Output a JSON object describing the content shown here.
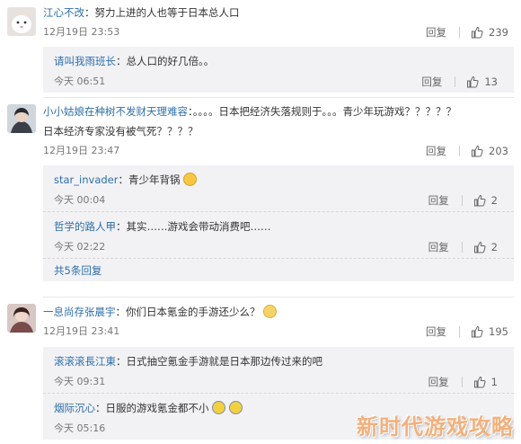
{
  "comments": [
    {
      "user": "江心不改",
      "text": "：努力上进的人也等于日本总人口",
      "time": "12月19日 23:53",
      "reply": "回复",
      "likes": "239",
      "replies": [
        {
          "user": "请叫我雨班长",
          "text": "：总人口的好几倍。。",
          "time": "今天 06:51",
          "reply": "回复",
          "likes": "13"
        }
      ]
    },
    {
      "user": "小小姑娘在种树不发财天理难容",
      "text_line1": "：。。。。日本把经济失落规则于。。。青少年玩游戏？？？？？",
      "text_line2": "日本经济专家没有被气死？？？？",
      "time": "12月19日 23:47",
      "reply": "回复",
      "likes": "203",
      "replies": [
        {
          "user": "star_invader",
          "text": "：青少年背锅",
          "time": "今天 00:04",
          "reply": "回复",
          "likes": "2"
        },
        {
          "user": "哲学的路人甲",
          "text": "：其实……游戏会带动消费吧……",
          "time": "今天 02:22",
          "reply": "回复",
          "likes": "2"
        }
      ],
      "more": "共5条回复"
    },
    {
      "user": "一息尚存张晨宇",
      "text": "：你们日本氪金的手游还少么？",
      "time": "12月19日 23:41",
      "reply": "回复",
      "likes": "195",
      "replies": [
        {
          "user": "滚滚滚長江東",
          "text": "：日式抽空氪金手游就是日本那边传过来的吧",
          "time": "今天 09:31",
          "reply": "回复",
          "likes": "1"
        },
        {
          "user": "烟际沉心",
          "text": "：日服的游戏氪金都不小",
          "time": "今天 05:16",
          "reply": "回复",
          "likes": ""
        }
      ]
    }
  ],
  "watermark": "新时代游戏攻略",
  "colors": {
    "link": "#2e6ea8",
    "meta": "#777777",
    "subbox": "#f2f2f5",
    "watermark": "#f2b07c"
  }
}
